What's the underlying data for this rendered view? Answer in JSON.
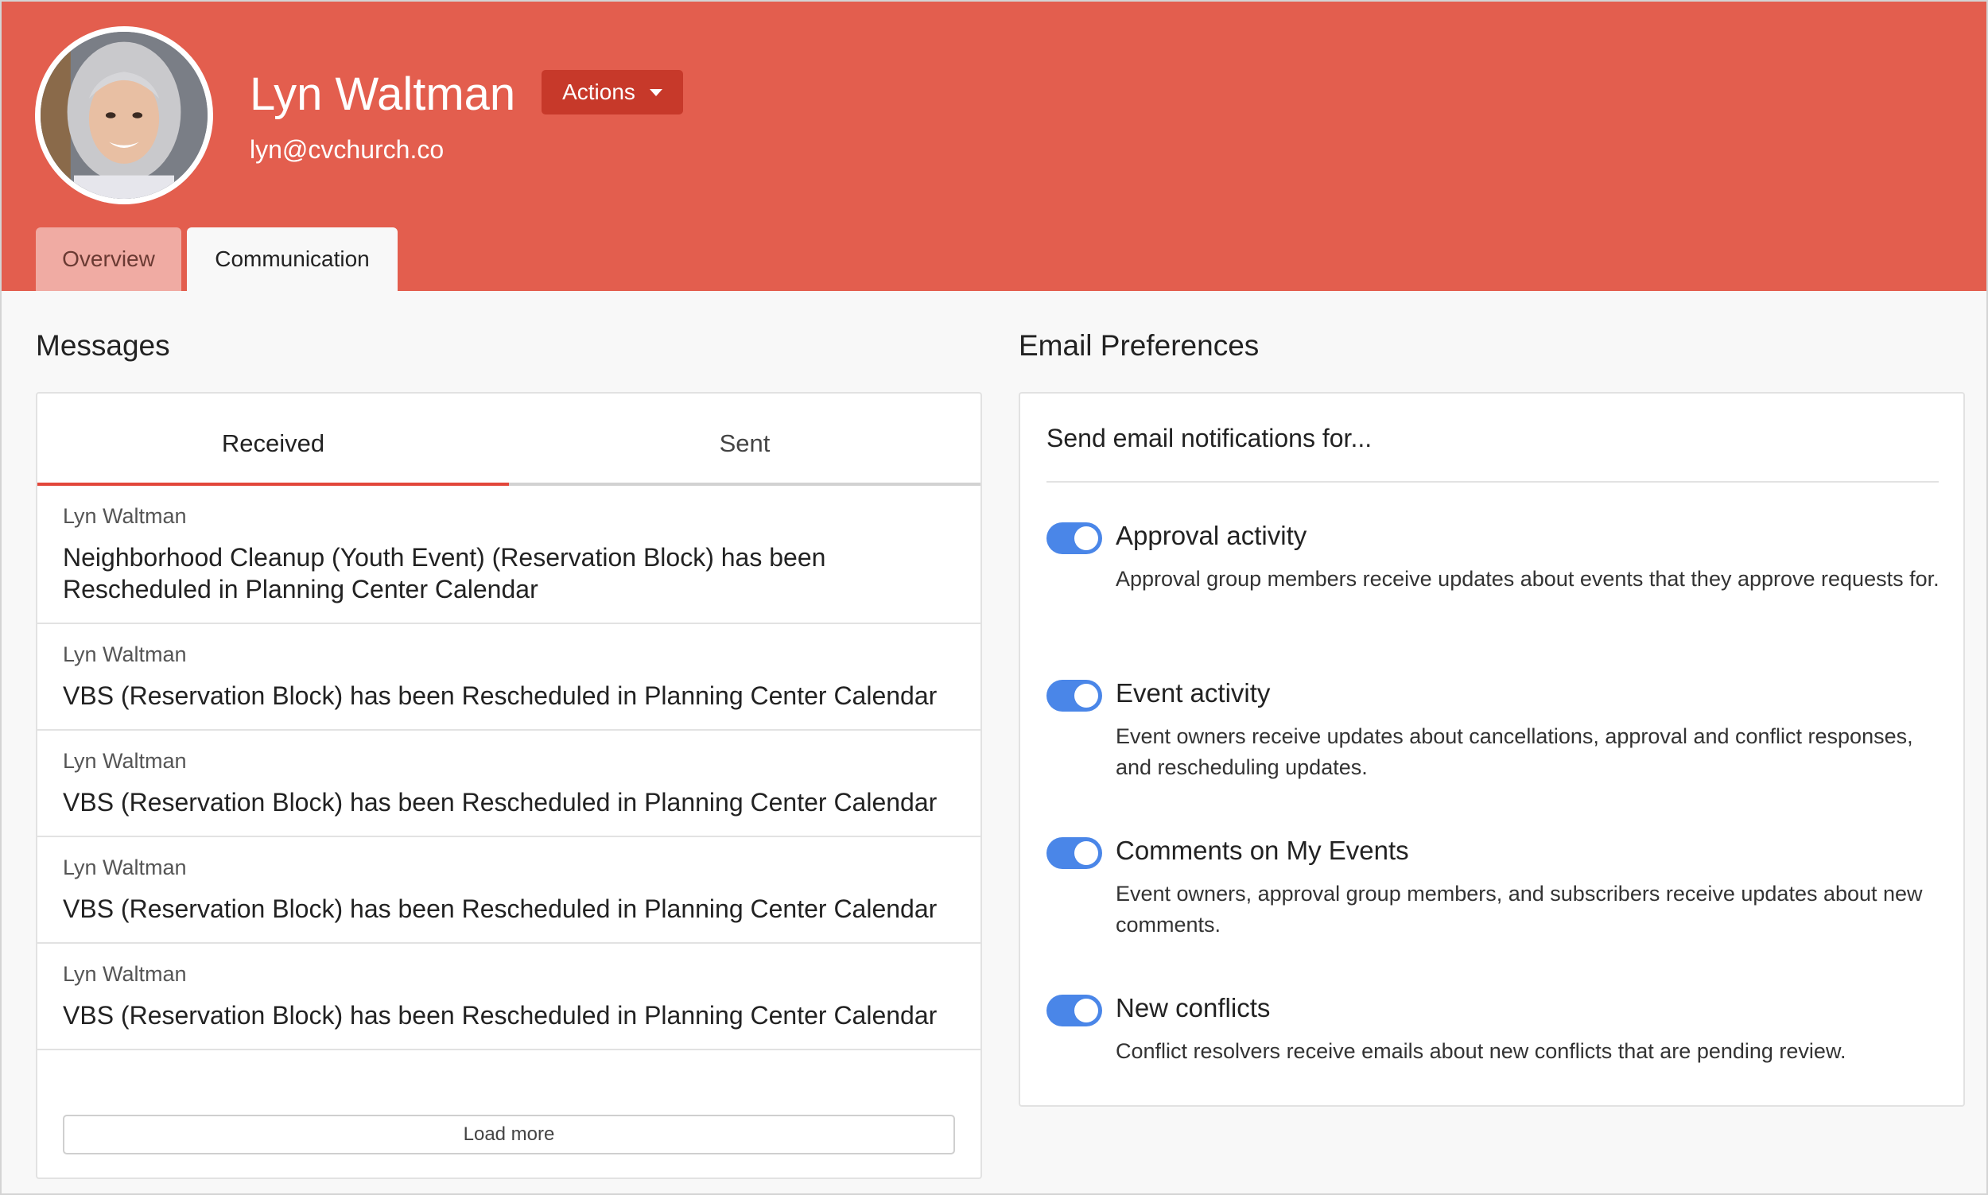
{
  "profile": {
    "name": "Lyn Waltman",
    "email": "lyn@cvchurch.co",
    "actions_label": "Actions"
  },
  "tabs": [
    {
      "label": "Overview",
      "active": false
    },
    {
      "label": "Communication",
      "active": true
    }
  ],
  "messages": {
    "title": "Messages",
    "tabs": [
      {
        "label": "Received",
        "active": true
      },
      {
        "label": "Sent",
        "active": false
      }
    ],
    "items": [
      {
        "sender": "Lyn Waltman",
        "subject": "Neighborhood Cleanup (Youth Event) (Reservation Block) has been Rescheduled in Planning Center Calendar"
      },
      {
        "sender": "Lyn Waltman",
        "subject": "VBS (Reservation Block) has been Rescheduled in Planning Center Calendar"
      },
      {
        "sender": "Lyn Waltman",
        "subject": "VBS (Reservation Block) has been Rescheduled in Planning Center Calendar"
      },
      {
        "sender": "Lyn Waltman",
        "subject": "VBS (Reservation Block) has been Rescheduled in Planning Center Calendar"
      },
      {
        "sender": "Lyn Waltman",
        "subject": "VBS (Reservation Block) has been Rescheduled in Planning Center Calendar"
      }
    ],
    "load_more_label": "Load more"
  },
  "email_preferences": {
    "title": "Email Preferences",
    "intro": "Send email notifications for...",
    "items": [
      {
        "label": "Approval activity",
        "enabled": true,
        "description": "Approval group members receive updates about events that they approve requests for."
      },
      {
        "label": "Event activity",
        "enabled": true,
        "description": "Event owners receive updates about cancellations, approval and conflict responses, and rescheduling updates."
      },
      {
        "label": "Comments on My Events",
        "enabled": true,
        "description": "Event owners, approval group members, and subscribers receive updates about new comments."
      },
      {
        "label": "New conflicts",
        "enabled": true,
        "description": "Conflict resolvers receive emails about new conflicts that are pending review."
      }
    ]
  },
  "colors": {
    "header": "#e35e4e",
    "actions_button": "#c7392a",
    "active_tab_underline": "#e2463a",
    "toggle_on": "#4a86e8"
  }
}
